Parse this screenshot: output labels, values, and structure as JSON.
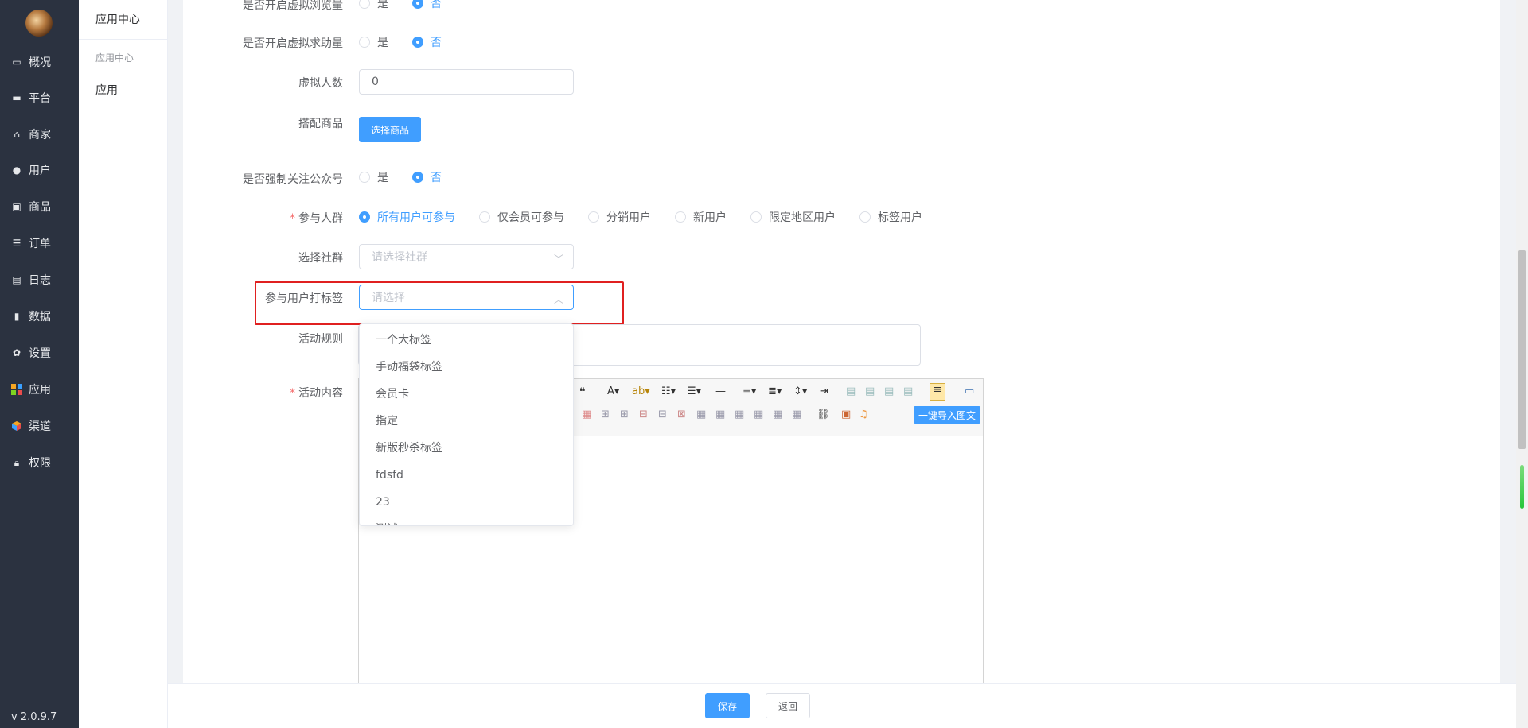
{
  "nav": {
    "items": [
      {
        "label": "概况",
        "icon": "monitor-icon"
      },
      {
        "label": "平台",
        "icon": "desktop-icon"
      },
      {
        "label": "商家",
        "icon": "shop-icon"
      },
      {
        "label": "用户",
        "icon": "user-icon"
      },
      {
        "label": "商品",
        "icon": "goods-icon"
      },
      {
        "label": "订单",
        "icon": "order-icon"
      },
      {
        "label": "日志",
        "icon": "log-icon"
      },
      {
        "label": "数据",
        "icon": "chart-icon"
      },
      {
        "label": "设置",
        "icon": "gear-icon"
      },
      {
        "label": "应用",
        "icon": "apps-icon"
      },
      {
        "label": "渠道",
        "icon": "cube-icon"
      },
      {
        "label": "权限",
        "icon": "lock-icon"
      }
    ],
    "version": "v 2.0.9.7"
  },
  "subnav": {
    "title": "应用中心",
    "group": "应用中心",
    "item": "应用"
  },
  "form": {
    "virtual_views": {
      "label": "是否开启虚拟浏览量",
      "yes": "是",
      "no": "否",
      "selected": "no"
    },
    "virtual_help": {
      "label": "是否开启虚拟求助量",
      "yes": "是",
      "no": "否",
      "selected": "no"
    },
    "virtual_people": {
      "label": "虚拟人数",
      "value": "0"
    },
    "match_goods": {
      "label": "搭配商品",
      "button": "选择商品"
    },
    "force_follow": {
      "label": "是否强制关注公众号",
      "yes": "是",
      "no": "否",
      "selected": "no"
    },
    "audience": {
      "required": "*",
      "label": "参与人群",
      "options": [
        "所有用户可参与",
        "仅会员可参与",
        "分销用户",
        "新用户",
        "限定地区用户",
        "标签用户"
      ],
      "selected": 0
    },
    "community": {
      "label": "选择社群",
      "placeholder": "请选择社群"
    },
    "user_tag": {
      "label": "参与用户打标签",
      "placeholder": "请选择"
    },
    "rules": {
      "label": "活动规则"
    },
    "content": {
      "required": "*",
      "label": "活动内容",
      "import_button": "一键导入图文"
    }
  },
  "dropdown": {
    "options": [
      "一个大标签",
      "手动福袋标签",
      "会员卡",
      "指定",
      "新版秒杀标签",
      "fdsfd",
      "23",
      "测试"
    ]
  },
  "footer": {
    "save": "保存",
    "back": "返回"
  },
  "colors": {
    "primary": "#409eff",
    "sidebar": "#2b3240",
    "highlight": "#e02020"
  }
}
